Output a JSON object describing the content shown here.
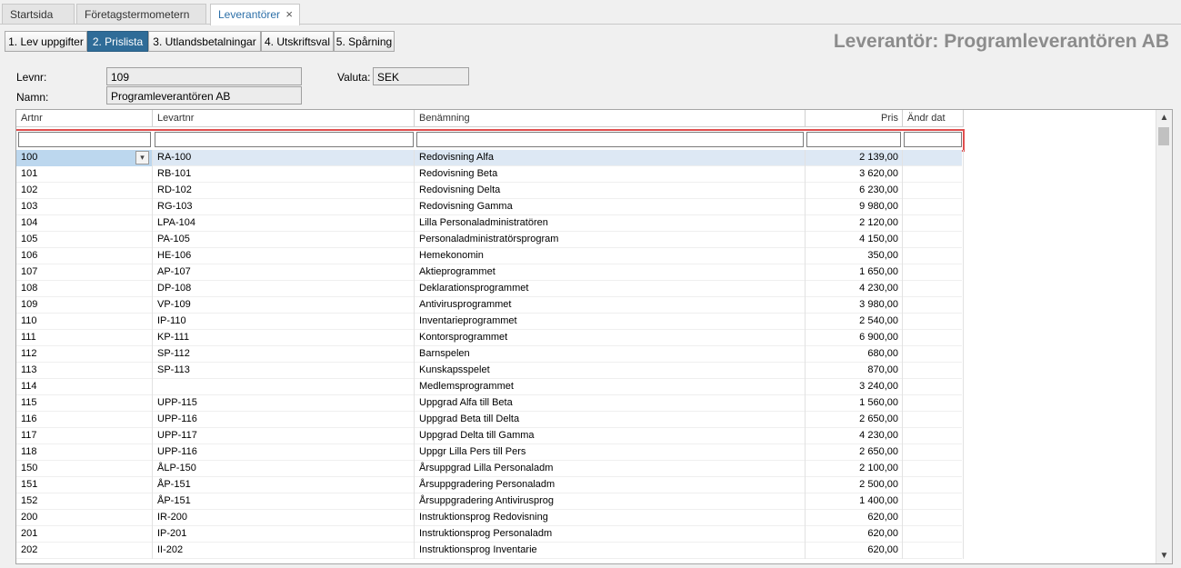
{
  "doc_tabs": [
    {
      "label": "Startsida"
    },
    {
      "label": "Företagstermometern"
    },
    {
      "label": "Leverantörer",
      "close": "×"
    }
  ],
  "steps": [
    {
      "label": "1. Lev uppgifter"
    },
    {
      "label": "2. Prislista"
    },
    {
      "label": "3. Utlandsbetalningar"
    },
    {
      "label": "4. Utskriftsval"
    },
    {
      "label": "5. Spårning"
    }
  ],
  "page_title": "Leverantör: Programleverantören AB",
  "form": {
    "levnr_label": "Levnr:",
    "levnr_value": "109",
    "namn_label": "Namn:",
    "namn_value": "Programleverantören AB",
    "valuta_label": "Valuta:",
    "valuta_value": "SEK"
  },
  "columns": [
    "Artnr",
    "Levartnr",
    "Benämning",
    "Pris",
    "Ändr dat"
  ],
  "rows": [
    {
      "artnr": "100",
      "levartnr": "RA-100",
      "benamning": "Redovisning Alfa",
      "pris": "2 139,00",
      "andr": ""
    },
    {
      "artnr": "101",
      "levartnr": "RB-101",
      "benamning": "Redovisning Beta",
      "pris": "3 620,00",
      "andr": ""
    },
    {
      "artnr": "102",
      "levartnr": "RD-102",
      "benamning": "Redovisning Delta",
      "pris": "6 230,00",
      "andr": ""
    },
    {
      "artnr": "103",
      "levartnr": "RG-103",
      "benamning": "Redovisning Gamma",
      "pris": "9 980,00",
      "andr": ""
    },
    {
      "artnr": "104",
      "levartnr": "LPA-104",
      "benamning": "Lilla Personaladministratören",
      "pris": "2 120,00",
      "andr": ""
    },
    {
      "artnr": "105",
      "levartnr": "PA-105",
      "benamning": "Personaladministratörsprogram",
      "pris": "4 150,00",
      "andr": ""
    },
    {
      "artnr": "106",
      "levartnr": "HE-106",
      "benamning": "Hemekonomin",
      "pris": "350,00",
      "andr": ""
    },
    {
      "artnr": "107",
      "levartnr": "AP-107",
      "benamning": "Aktieprogrammet",
      "pris": "1 650,00",
      "andr": ""
    },
    {
      "artnr": "108",
      "levartnr": "DP-108",
      "benamning": "Deklarationsprogrammet",
      "pris": "4 230,00",
      "andr": ""
    },
    {
      "artnr": "109",
      "levartnr": "VP-109",
      "benamning": "Antivirusprogrammet",
      "pris": "3 980,00",
      "andr": ""
    },
    {
      "artnr": "110",
      "levartnr": "IP-110",
      "benamning": "Inventarieprogrammet",
      "pris": "2 540,00",
      "andr": ""
    },
    {
      "artnr": "111",
      "levartnr": "KP-111",
      "benamning": "Kontorsprogrammet",
      "pris": "6 900,00",
      "andr": ""
    },
    {
      "artnr": "112",
      "levartnr": "SP-112",
      "benamning": "Barnspelen",
      "pris": "680,00",
      "andr": ""
    },
    {
      "artnr": "113",
      "levartnr": "SP-113",
      "benamning": "Kunskapsspelet",
      "pris": "870,00",
      "andr": ""
    },
    {
      "artnr": "114",
      "levartnr": "",
      "benamning": "Medlemsprogrammet",
      "pris": "3 240,00",
      "andr": ""
    },
    {
      "artnr": "115",
      "levartnr": "UPP-115",
      "benamning": "Uppgrad Alfa till Beta",
      "pris": "1 560,00",
      "andr": ""
    },
    {
      "artnr": "116",
      "levartnr": "UPP-116",
      "benamning": "Uppgrad Beta till Delta",
      "pris": "2 650,00",
      "andr": ""
    },
    {
      "artnr": "117",
      "levartnr": "UPP-117",
      "benamning": "Uppgrad Delta till Gamma",
      "pris": "4 230,00",
      "andr": ""
    },
    {
      "artnr": "118",
      "levartnr": "UPP-116",
      "benamning": "Uppgr Lilla Pers  till Pers",
      "pris": "2 650,00",
      "andr": ""
    },
    {
      "artnr": "150",
      "levartnr": "ÅLP-150",
      "benamning": "Årsuppgrad Lilla Personaladm",
      "pris": "2 100,00",
      "andr": ""
    },
    {
      "artnr": "151",
      "levartnr": "ÅP-151",
      "benamning": "Årsuppgradering Personaladm",
      "pris": "2 500,00",
      "andr": ""
    },
    {
      "artnr": "152",
      "levartnr": "ÅP-151",
      "benamning": "Årsuppgradering Antivirusprog",
      "pris": "1 400,00",
      "andr": ""
    },
    {
      "artnr": "200",
      "levartnr": "IR-200",
      "benamning": "Instruktionsprog Redovisning",
      "pris": "620,00",
      "andr": ""
    },
    {
      "artnr": "201",
      "levartnr": "IP-201",
      "benamning": "Instruktionsprog Personaladm",
      "pris": "620,00",
      "andr": ""
    },
    {
      "artnr": "202",
      "levartnr": "II-202",
      "benamning": "Instruktionsprog Inventarie",
      "pris": "620,00",
      "andr": ""
    }
  ],
  "selected_row": 0,
  "icons": {
    "dropdown": "chevron-down-icon",
    "close": "close-icon",
    "scroll_up": "scroll-up-icon",
    "scroll_down": "scroll-down-icon"
  },
  "colors": {
    "active_step": "#2f6c98",
    "active_tab_text": "#2c6fa8",
    "filter_highlight": "#e04f4f",
    "selected_row": "#dde8f4"
  }
}
